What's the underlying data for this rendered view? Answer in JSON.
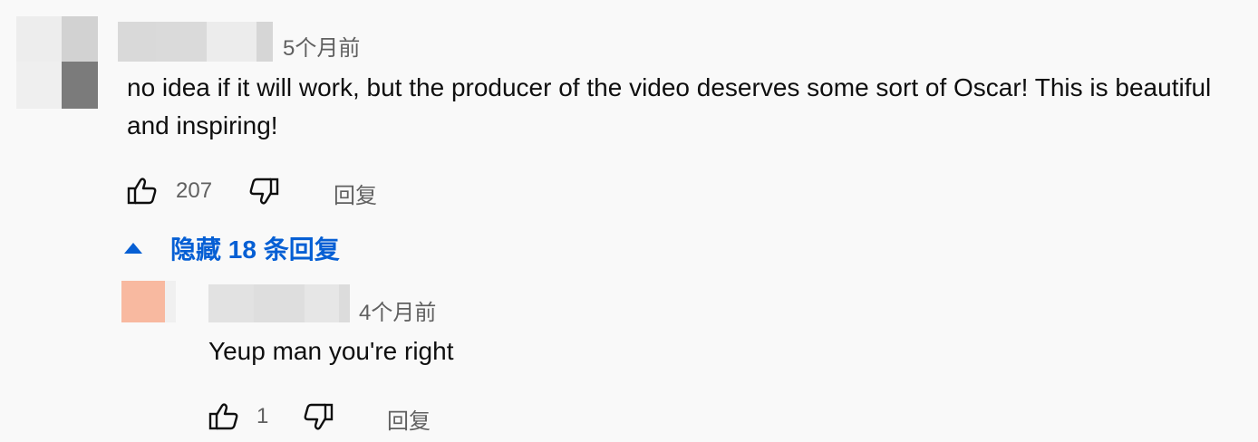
{
  "comment": {
    "timestamp": "5个月前",
    "text": "no idea if it will work, but the producer of the video deserves some sort of Oscar! This is beautiful and inspiring!",
    "like_count": "207",
    "reply_label": "回复",
    "icons": {
      "like": "thumb-up-icon",
      "dislike": "thumb-down-icon"
    }
  },
  "replies_toggle": {
    "label": "隐藏 18 条回复",
    "icon": "caret-up-icon",
    "color": "#065fd4"
  },
  "reply": {
    "timestamp": "4个月前",
    "text": "Yeup man you're right",
    "like_count": "1",
    "reply_label": "回复",
    "icons": {
      "like": "thumb-up-icon",
      "dislike": "thumb-down-icon"
    }
  }
}
